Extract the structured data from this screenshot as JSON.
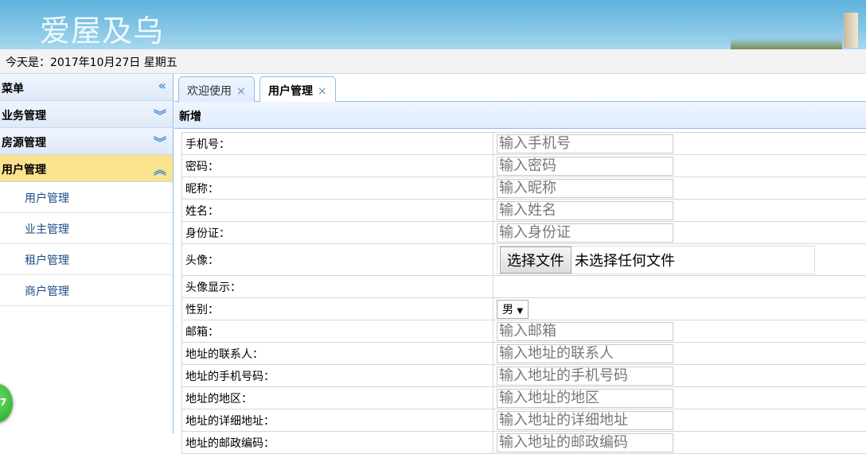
{
  "header": {
    "logo": "爱屋及乌"
  },
  "date_bar": "今天是：2017年10月27日 星期五",
  "sidebar": {
    "title": "菜单",
    "sections": [
      {
        "label": "业务管理"
      },
      {
        "label": "房源管理"
      },
      {
        "label": "用户管理",
        "active": true
      }
    ],
    "items": [
      {
        "label": "用户管理"
      },
      {
        "label": "业主管理"
      },
      {
        "label": "租户管理"
      },
      {
        "label": "商户管理"
      }
    ],
    "badge": "7"
  },
  "tabs": [
    {
      "label": "欢迎使用",
      "close": "×"
    },
    {
      "label": "用户管理",
      "close": "×",
      "active": true
    }
  ],
  "panel": {
    "title": "新增"
  },
  "form": {
    "rows": [
      {
        "label": "手机号：",
        "placeholder": "输入手机号"
      },
      {
        "label": "密码：",
        "placeholder": "输入密码"
      },
      {
        "label": "昵称：",
        "placeholder": "输入昵称"
      },
      {
        "label": "姓名：",
        "placeholder": "输入姓名"
      },
      {
        "label": "身份证：",
        "placeholder": "输入身份证"
      }
    ],
    "avatar_label": "头像：",
    "file_button": "选择文件",
    "file_status": "未选择任何文件",
    "avatar_display_label": "头像显示：",
    "gender_label": "性别：",
    "gender_value": "男",
    "rows2": [
      {
        "label": "邮箱：",
        "placeholder": "输入邮箱"
      },
      {
        "label": "地址的联系人：",
        "placeholder": "输入地址的联系人"
      },
      {
        "label": "地址的手机号码：",
        "placeholder": "输入地址的手机号码"
      },
      {
        "label": "地址的地区：",
        "placeholder": "输入地址的地区"
      },
      {
        "label": "地址的详细地址：",
        "placeholder": "输入地址的详细地址"
      },
      {
        "label": "地址的邮政编码：",
        "placeholder": "输入地址的邮政编码"
      }
    ]
  }
}
